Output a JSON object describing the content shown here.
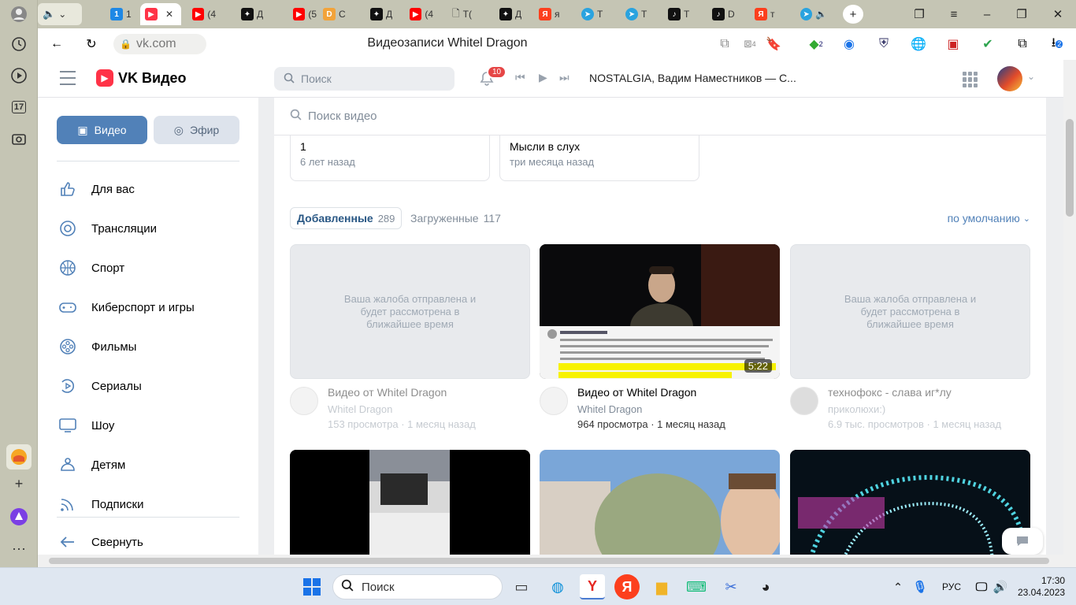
{
  "browser": {
    "tab_titles": [
      "1",
      "",
      "(4",
      "Д",
      "(5",
      "С",
      "Д",
      "(4",
      "Т(",
      "Д",
      "я",
      "Т",
      "Т",
      "Т",
      "D",
      "т",
      ""
    ],
    "active_tab_index": 2,
    "address": "vk.com",
    "page_title": "Видеозаписи Whitel Dragon",
    "rail_calendar": "17",
    "ext_badges": {
      "tabs_count": "4",
      "green_ext": "2",
      "downloads": "2"
    }
  },
  "header": {
    "logo_text": "VK Видео",
    "search_placeholder": "Поиск",
    "notifications_count": "10",
    "now_playing": "NOSTALGIA, Вадим Наместников — С..."
  },
  "sidebar": {
    "video_button": "Видео",
    "live_button": "Эфир",
    "items": [
      {
        "label": "Для вас",
        "icon": "thumbs-up-icon"
      },
      {
        "label": "Трансляции",
        "icon": "broadcast-icon"
      },
      {
        "label": "Спорт",
        "icon": "ball-icon"
      },
      {
        "label": "Киберспорт и игры",
        "icon": "gamepad-icon"
      },
      {
        "label": "Фильмы",
        "icon": "film-reel-icon"
      },
      {
        "label": "Сериалы",
        "icon": "series-icon"
      },
      {
        "label": "Шоу",
        "icon": "tv-icon"
      },
      {
        "label": "Детям",
        "icon": "kids-icon"
      },
      {
        "label": "Подписки",
        "icon": "subscriptions-icon"
      }
    ],
    "collapse_label": "Свернуть"
  },
  "content": {
    "video_search_placeholder": "Поиск видео",
    "playlists": [
      {
        "title": "1",
        "subtitle": "6 лет назад"
      },
      {
        "title": "Мысли в слух",
        "subtitle": "три месяца назад"
      }
    ],
    "tabs": [
      {
        "label": "Добавленные",
        "count": "289"
      },
      {
        "label": "Загруженные",
        "count": "117"
      }
    ],
    "sort_label": "по умолчанию",
    "blocked_text": "Ваша жалоба отправлена и будет рассмотрена в ближайшее время",
    "videos": [
      {
        "title": "Видео от Whitel Dragon",
        "author": "Whitel Dragon",
        "stats": "153 просмотра · 1 месяц назад",
        "blocked": true,
        "duration": ""
      },
      {
        "title": "Видео от Whitel Dragon",
        "author": "Whitel Dragon",
        "stats": "964 просмотра · 1 месяц назад",
        "blocked": false,
        "duration": "5:22"
      },
      {
        "title": "технофокс - слава иг*лу",
        "author": "приколюхи:)",
        "stats": "6.9 тыс. просмотров · 1 месяц назад",
        "blocked": true,
        "duration": ""
      }
    ]
  },
  "taskbar": {
    "search_label": "Поиск",
    "lang": "РУС",
    "time": "17:30",
    "date": "23.04.2023"
  },
  "colors": {
    "vk_blue": "#5181b8",
    "vk_red": "#ff3347",
    "badge_red": "#e64646",
    "rail": "#c5c5b4"
  }
}
